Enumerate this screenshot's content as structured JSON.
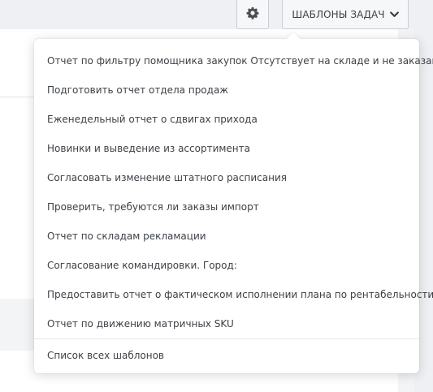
{
  "toolbar": {
    "settings_icon": "gear-icon",
    "templates_label": "ШАБЛОНЫ ЗАДАЧ",
    "templates_chevron_icon": "chevron-down-icon"
  },
  "templates_menu": {
    "items": [
      {
        "label": "Отчет по фильтру помощника закупок Отсутствует на складе и не заказан"
      },
      {
        "label": "Подготовить отчет отдела продаж"
      },
      {
        "label": "Еженедельный отчет о сдвигах прихода"
      },
      {
        "label": "Новинки и выведение из ассортимента"
      },
      {
        "label": "Согласовать изменение штатного расписания"
      },
      {
        "label": "Проверить, требуются ли заказы импорт"
      },
      {
        "label": "Отчет по складам рекламации"
      },
      {
        "label": "Согласование командировки. Город:"
      },
      {
        "label": "Предоставить отчет о фактическом исполнении плана по рентабельности"
      },
      {
        "label": "Отчет по движению матричных SKU"
      }
    ],
    "footer_label": "Список всех шаблонов"
  },
  "colors": {
    "background": "#eef0f3",
    "text": "#3d4146",
    "border": "#c9ced4"
  }
}
